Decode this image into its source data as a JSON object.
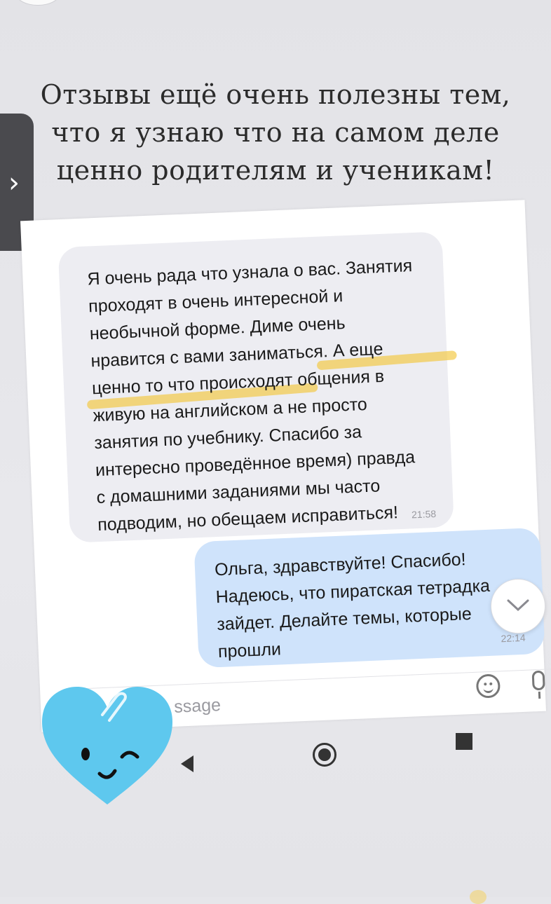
{
  "story": {
    "heading_lines": [
      "Отзывы ещё очень полезны тем,",
      "что я узнаю что на самом деле",
      "ценно родителям и ученикам!"
    ],
    "nav_arrow": "›"
  },
  "chat": {
    "incoming": {
      "lines": [
        "Я очень рада что узнала о вас. Занятия",
        "проходят в очень интересной и",
        "необычной форме. Диме очень",
        "нравится с вами заниматься. А еще",
        "ценно то что происходят общения в",
        "живую на английском а не просто",
        "занятия по учебнику. Спасибо за",
        "интересно проведённое время) правда",
        "с домашними заданиями мы часто",
        "подводим, но обещаем исправиться!"
      ],
      "time": "21:58"
    },
    "outgoing": {
      "lines": [
        "Ольга, здравствуйте! Спасибо!",
        "Надеюсь, что пиратская тетрадка",
        "зайдет. Делайте темы, которые",
        "прошли"
      ],
      "time": "22:14"
    },
    "input_placeholder": "ssage"
  },
  "colors": {
    "highlight": "#f3c63a",
    "outgoing_bubble": "#cfe3fb",
    "incoming_bubble": "#ededf2",
    "heart": "#5ec8ee"
  },
  "icons": [
    "chevron-right-icon",
    "emoji-icon",
    "microphone-icon",
    "attachment-icon",
    "back-icon",
    "home-icon",
    "recents-icon",
    "chevron-down-icon",
    "heart-sticker-icon"
  ]
}
